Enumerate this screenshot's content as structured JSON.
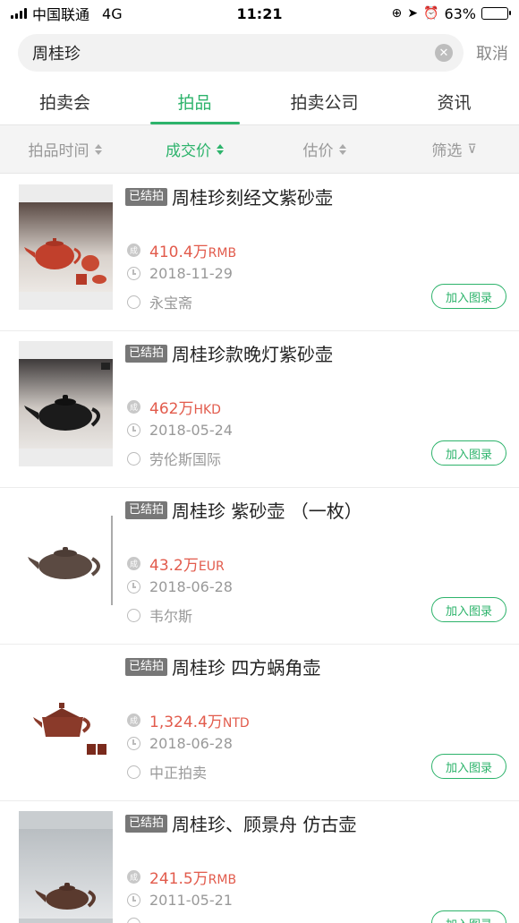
{
  "status_bar": {
    "carrier": "中国联通",
    "network": "4G",
    "time": "11:21",
    "battery": "63%",
    "battery_level": 0.63
  },
  "search": {
    "value": "周桂珍",
    "cancel_label": "取消"
  },
  "main_tabs": [
    {
      "label": "拍卖会",
      "active": false
    },
    {
      "label": "拍品",
      "active": true
    },
    {
      "label": "拍卖公司",
      "active": false
    },
    {
      "label": "资讯",
      "active": false
    }
  ],
  "sort_bar": [
    {
      "label": "拍品时间",
      "active": false
    },
    {
      "label": "成交价",
      "active": true
    },
    {
      "label": "估价",
      "active": false
    },
    {
      "label": "筛选",
      "active": false
    }
  ],
  "lots": [
    {
      "status": "已结拍",
      "title": "周桂珍刻经文紫砂壶",
      "price": "410.4万",
      "currency": "RMB",
      "date": "2018-11-29",
      "house": "永宝斋",
      "button": "加入图录"
    },
    {
      "status": "已结拍",
      "title": "周桂珍款晚灯紫砂壶",
      "price": "462万",
      "currency": "HKD",
      "date": "2018-05-24",
      "house": "劳伦斯国际",
      "button": "加入图录"
    },
    {
      "status": "已结拍",
      "title": "周桂珍 紫砂壶 （一枚）",
      "price": "43.2万",
      "currency": "EUR",
      "date": "2018-06-28",
      "house": "韦尔斯",
      "button": "加入图录"
    },
    {
      "status": "已结拍",
      "title": "周桂珍 四方蜗角壶",
      "price": "1,324.4万",
      "currency": "NTD",
      "date": "2018-06-28",
      "house": "中正拍卖",
      "button": "加入图录"
    },
    {
      "status": "已结拍",
      "title": "周桂珍、顾景舟 仿古壶",
      "price": "241.5万",
      "currency": "RMB",
      "date": "2011-05-21",
      "house": "",
      "button": "加入图录"
    }
  ],
  "colors": {
    "accent": "#2db36b",
    "price": "#e25b4c",
    "muted": "#999999"
  }
}
